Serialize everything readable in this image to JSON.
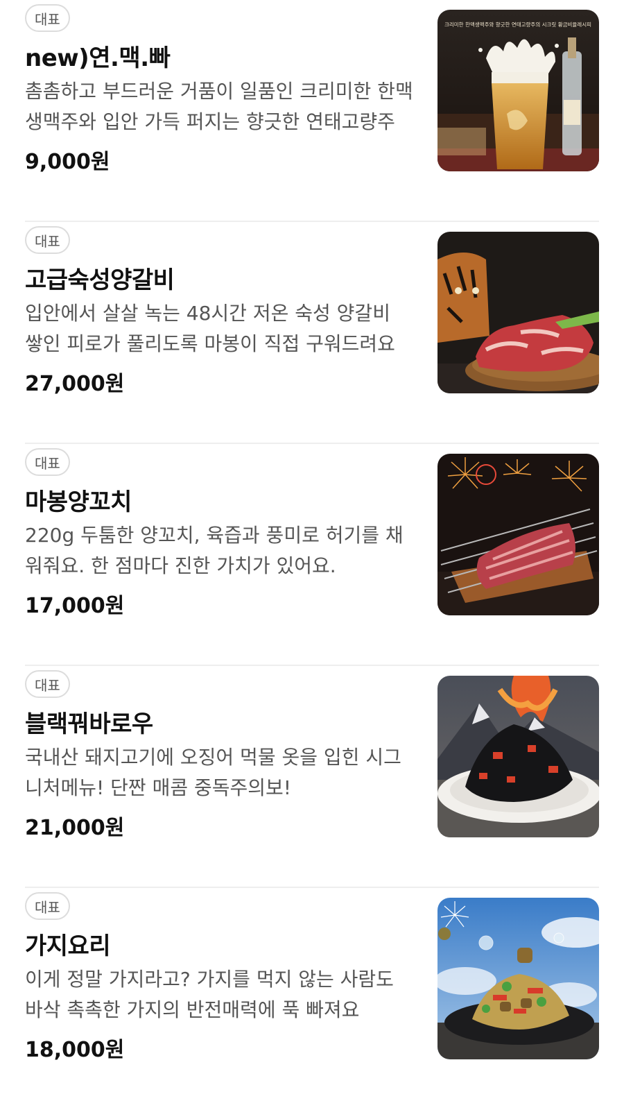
{
  "items": [
    {
      "badge": "대표",
      "name": "new)연.맥.빠",
      "desc": "촘촘하고 부드러운 거품이 일품인 크리미한 한맥생맥주와 입안 가득 퍼지는 향긋한 연태고량주",
      "price": "9,000원",
      "image_caption": "크리미한 한맥생맥주와 향긋한 연태고량주의 시크릿 황금비율레시피",
      "image": "beer-splash-photo"
    },
    {
      "badge": "대표",
      "name": "고급숙성양갈비",
      "desc": "입안에서 살살 녹는 48시간 저온 숙성 양갈비 쌓인 피로가 풀리도록 마봉이 직접 구워드려요",
      "price": "27,000원",
      "image": "lamb-ribs-tiger-photo"
    },
    {
      "badge": "대표",
      "name": "마봉양꼬치",
      "desc": "220g 두툼한 양꼬치, 육즙과 풍미로 허기를 채워줘요. 한 점마다 진한 가치가 있어요.",
      "price": "17,000원",
      "image": "lamb-skewers-fireworks-photo"
    },
    {
      "badge": "대표",
      "name": "블랙꿔바로우",
      "desc": "국내산 돼지고기에 오징어 먹물 옷을 입힌 시그니처메뉴! 단짠 매콤 중독주의보!",
      "price": "21,000원",
      "image": "black-guobaorou-volcano-photo"
    },
    {
      "badge": "대표",
      "name": "가지요리",
      "desc": "이게 정말 가지라고? 가지를 먹지 않는 사람도 바삭 촉촉한 가지의 반전매력에 푹 빠져요",
      "price": "18,000원",
      "image": "eggplant-dish-photo"
    }
  ]
}
